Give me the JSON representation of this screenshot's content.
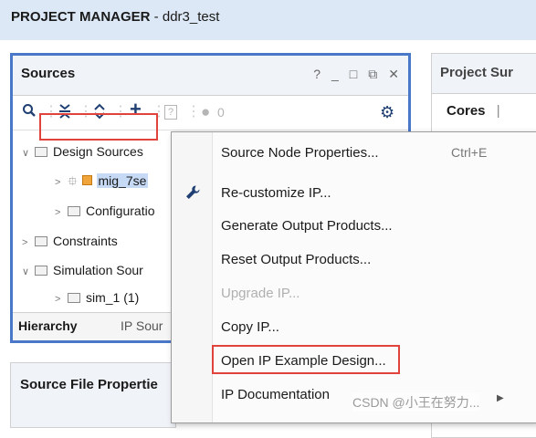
{
  "title_bar": {
    "section": "PROJECT MANAGER",
    "separator": " - ",
    "project": "ddr3_test"
  },
  "sources": {
    "title": "Sources",
    "window_controls": [
      "?",
      "_",
      "□",
      "⧉",
      "✕"
    ],
    "toolbar": {
      "search": "search-icon",
      "collapse": "collapse-all-icon",
      "expand": "expand-all-icon",
      "add": "+",
      "help": "?",
      "count": "0"
    },
    "tree": {
      "design_sources": "Design Sources",
      "ip_item": "mig_7se",
      "configuration": "Configuratio",
      "constraints": "Constraints",
      "simulation_sources": "Simulation Sour",
      "sim_1": "sim_1 (1)"
    },
    "tabs": {
      "hierarchy": "Hierarchy",
      "ip_sources": "IP Sour"
    }
  },
  "source_file_properties": {
    "title": "Source File Propertie"
  },
  "project_summary": {
    "title": "Project Sur",
    "tab_cores": "Cores",
    "separator": "|"
  },
  "context_menu": {
    "items": [
      {
        "label": "Source Node Properties...",
        "shortcut": "Ctrl+E"
      },
      {
        "label": "Re-customize IP..."
      },
      {
        "label": "Generate Output Products..."
      },
      {
        "label": "Reset Output Products..."
      },
      {
        "label": "Upgrade IP..."
      },
      {
        "label": "Copy IP..."
      },
      {
        "label": "Open IP Example Design..."
      },
      {
        "label": "IP Documentation"
      }
    ]
  },
  "watermark": "CSDN @小王在努力...",
  "colors": {
    "accent_border": "#4a78c8",
    "highlight_red": "#e0433b",
    "selection": "#c7daf5"
  }
}
